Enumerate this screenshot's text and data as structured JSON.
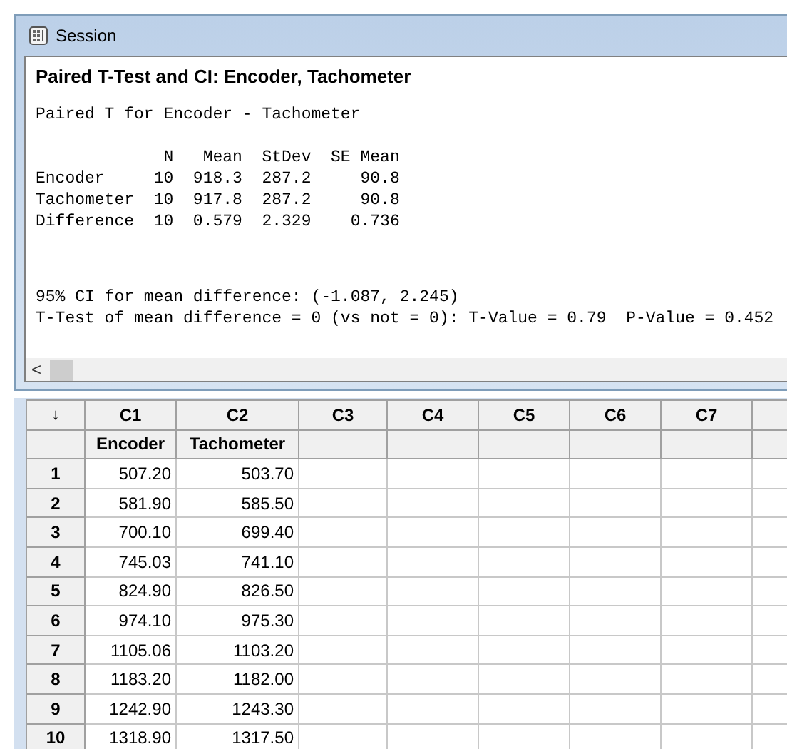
{
  "session": {
    "title": "Session",
    "heading": "Paired T-Test and CI: Encoder, Tachometer",
    "output_blocks": [
      [
        "Paired T for Encoder - Tachometer"
      ],
      [
        "             N   Mean  StDev  SE Mean",
        "Encoder     10  918.3  287.2     90.8",
        "Tachometer  10  917.8  287.2     90.8",
        "Difference  10  0.579  2.329    0.736"
      ],
      [
        "95% CI for mean difference: (-1.087, 2.245)",
        "T-Test of mean difference = 0 (vs not = 0): T-Value = 0.79  P-Value = 0.452"
      ]
    ],
    "scroll_left": "<"
  },
  "worksheet": {
    "corner": "↓",
    "columns": [
      {
        "id": "C1",
        "name": "Encoder"
      },
      {
        "id": "C2",
        "name": "Tachometer"
      },
      {
        "id": "C3"
      },
      {
        "id": "C4"
      },
      {
        "id": "C5"
      },
      {
        "id": "C6"
      },
      {
        "id": "C7"
      }
    ],
    "rows": [
      {
        "number": "1",
        "cells": [
          "507.20",
          "503.70"
        ]
      },
      {
        "number": "2",
        "cells": [
          "581.90",
          "585.50"
        ]
      },
      {
        "number": "3",
        "cells": [
          "700.10",
          "699.40"
        ]
      },
      {
        "number": "4",
        "cells": [
          "745.03",
          "741.10"
        ]
      },
      {
        "number": "5",
        "cells": [
          "824.90",
          "826.50"
        ]
      },
      {
        "number": "6",
        "cells": [
          "974.10",
          "975.30"
        ]
      },
      {
        "number": "7",
        "cells": [
          "1105.06",
          "1103.20"
        ]
      },
      {
        "number": "8",
        "cells": [
          "1183.20",
          "1182.00"
        ]
      },
      {
        "number": "9",
        "cells": [
          "1242.90",
          "1243.30"
        ]
      },
      {
        "number": "10",
        "cells": [
          "1318.90",
          "1317.50"
        ]
      }
    ]
  }
}
